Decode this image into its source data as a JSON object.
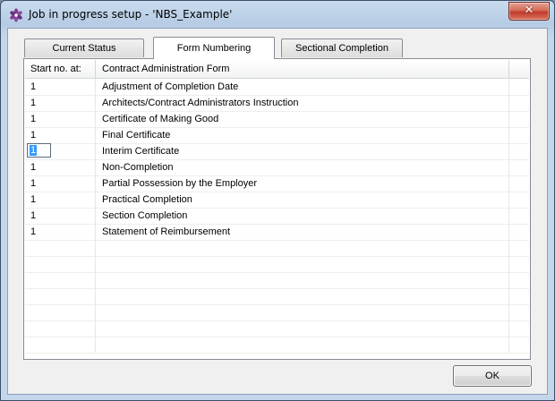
{
  "window": {
    "title": "Job in progress setup - 'NBS_Example'",
    "close_glyph": "✕"
  },
  "tabs": [
    {
      "label": "Current Status",
      "active": false
    },
    {
      "label": "Form Numbering",
      "active": true
    },
    {
      "label": "Sectional Completion",
      "active": false
    }
  ],
  "grid": {
    "columns": [
      "Start no. at:",
      "Contract Administration Form"
    ],
    "rows": [
      {
        "start": "1",
        "form": "Adjustment of Completion Date"
      },
      {
        "start": "1",
        "form": "Architects/Contract Administrators Instruction"
      },
      {
        "start": "1",
        "form": "Certificate of Making Good"
      },
      {
        "start": "1",
        "form": "Final Certificate"
      },
      {
        "start": "1",
        "form": "Interim Certificate",
        "editing": true
      },
      {
        "start": "1",
        "form": "Non-Completion"
      },
      {
        "start": "1",
        "form": "Partial Possession by the Employer"
      },
      {
        "start": "1",
        "form": "Practical Completion"
      },
      {
        "start": "1",
        "form": "Section Completion"
      },
      {
        "start": "1",
        "form": "Statement of Reimbursement"
      }
    ]
  },
  "buttons": {
    "ok": "OK"
  },
  "colors": {
    "selection": "#3399ff",
    "close_button": "#c0392b"
  }
}
